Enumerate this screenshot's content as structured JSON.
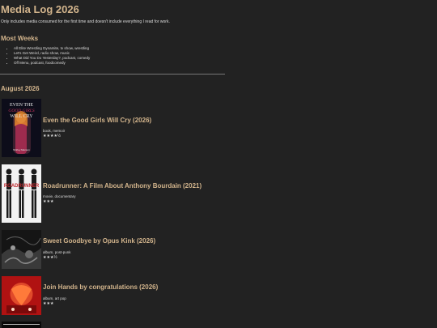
{
  "page": {
    "title": "Media Log 2026",
    "intro": "Only includes media consumed for the first time and doesn't include everything I read for work."
  },
  "most_weeks": {
    "heading": "Most Weeks",
    "items": [
      "All Elite Wrestling Dynamite, tv show, wrestling",
      "Let's Get Weird, radio show, music",
      "What Did You Do Yesterday?, podcast, comedy",
      "Off Menu, podcast, foodcomedy"
    ]
  },
  "month": {
    "heading": "August 2026",
    "entries": [
      {
        "title": "Even the Good Girls Will Cry (2026)",
        "meta": "book, memoir",
        "rating": "★★★★½",
        "cover": {
          "lines": [
            "EVEN THE",
            "GOOD GIRLS",
            "WILL CRY"
          ],
          "author": "Shirley Manson",
          "colors": {
            "bg": "#0d0d1a",
            "accent": "#c0305a",
            "text": "#e8e8e8"
          }
        }
      },
      {
        "title": "Roadrunner: A Film About Anthony Bourdain (2021)",
        "meta": "movie, documentary",
        "rating": "★★★",
        "cover": {
          "lines": [
            "ROADRUNNER"
          ],
          "colors": {
            "bg": "#f2f2f2",
            "accent": "#c0282d",
            "text": "#111111"
          }
        }
      },
      {
        "title": "Sweet Goodbye by Opus Kink (2026)",
        "meta": "album, post-punk",
        "rating": "★★★½",
        "cover": {
          "colors": {
            "bg": "#151515",
            "accent": "#6a6a6a",
            "text": "#cccccc"
          }
        }
      },
      {
        "title": "Join Hands by congratulations (2026)",
        "meta": "album, art pop",
        "rating": "★★★",
        "cover": {
          "colors": {
            "bg": "#b01212",
            "accent": "#e04a2a",
            "text": "#ffd9c0"
          }
        }
      }
    ]
  }
}
